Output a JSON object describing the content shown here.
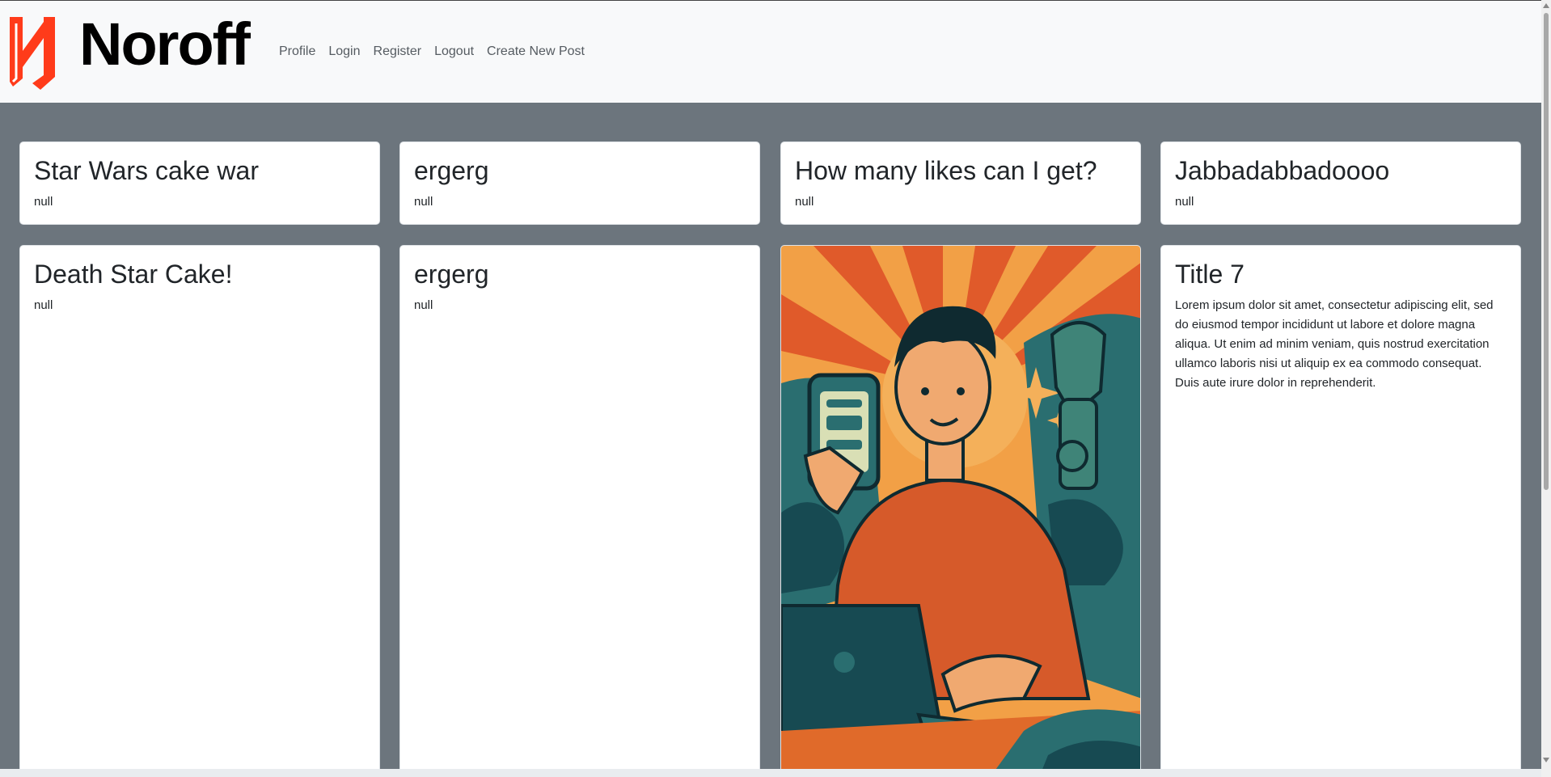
{
  "brand": {
    "name": "Noroff",
    "accent": "#ff3b1a"
  },
  "nav": {
    "items": [
      "Profile",
      "Login",
      "Register",
      "Logout",
      "Create New Post"
    ]
  },
  "posts": [
    {
      "title": "Star Wars cake war",
      "body": "null"
    },
    {
      "title": "ergerg",
      "body": "null"
    },
    {
      "title": "How many likes can I get?",
      "body": "null"
    },
    {
      "title": "Jabbadabbadoooo",
      "body": "null"
    },
    {
      "title": "Death Star Cake!",
      "body": "null"
    },
    {
      "title": "ergerg",
      "body": "null"
    },
    {
      "title": "",
      "body": "",
      "image": "illustration-man-with-phone-and-laptop"
    },
    {
      "title": "Title 7",
      "body": "Lorem ipsum dolor sit amet, consectetur adipiscing elit, sed do eiusmod tempor incididunt ut labore et dolore magna aliqua. Ut enim ad minim veniam, quis nostrud exercitation ullamco laboris nisi ut aliquip ex ea commodo consequat. Duis aute irure dolor in reprehenderit."
    }
  ],
  "colors": {
    "page_bg": "#6c757d",
    "navbar_bg": "#f8f9fa",
    "card_bg": "#ffffff"
  }
}
